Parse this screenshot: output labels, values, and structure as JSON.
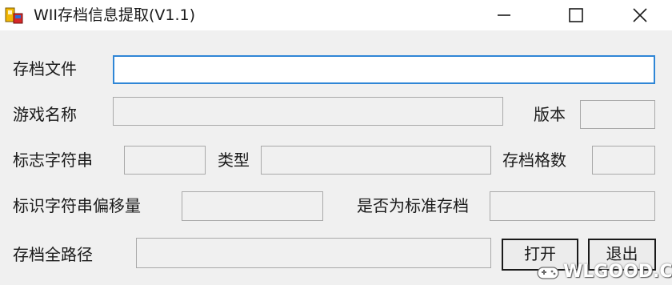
{
  "window": {
    "title": "WII存档信息提取(V1.1)",
    "icon": "app-icon",
    "controls": [
      "minimize-icon",
      "maximize-icon",
      "close-icon"
    ]
  },
  "form": {
    "save_file": {
      "label": "存档文件",
      "value": ""
    },
    "game_name": {
      "label": "游戏名称",
      "value": ""
    },
    "version": {
      "label": "版本",
      "value": ""
    },
    "flag_string": {
      "label": "标志字符串",
      "value": ""
    },
    "type": {
      "label": "类型",
      "value": ""
    },
    "save_slots": {
      "label": "存档格数",
      "value": ""
    },
    "id_offset": {
      "label": "标识字符串偏移量",
      "value": ""
    },
    "is_standard": {
      "label": "是否为标准存档",
      "value": ""
    },
    "full_path": {
      "label": "存档全路径",
      "value": ""
    }
  },
  "buttons": {
    "open": "打开",
    "exit": "退出"
  },
  "watermark": {
    "text": "WLGOOD.COM"
  },
  "colors": {
    "focus_border": "#2f86d6",
    "window_bg": "#f0f0f0"
  }
}
